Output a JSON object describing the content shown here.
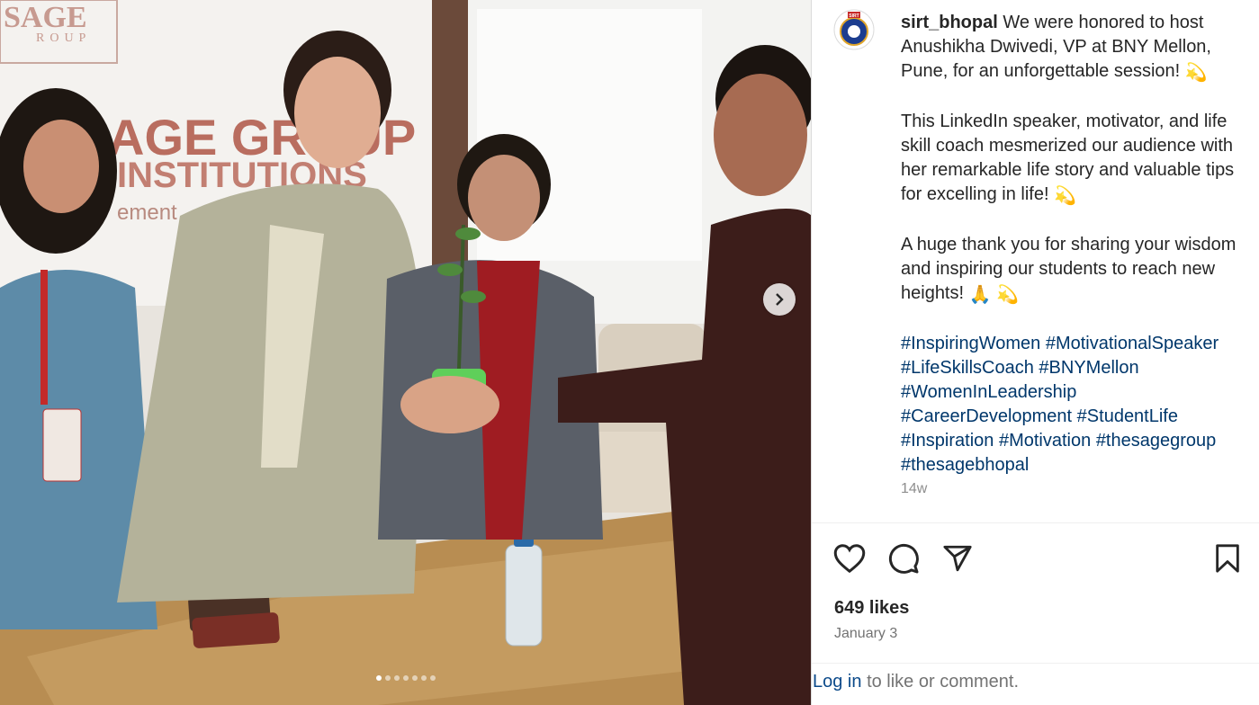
{
  "post": {
    "username": "sirt_bhopal",
    "avatar_text": "SIRT",
    "caption_paragraphs": [
      "We were honored to host Anushikha Dwivedi, VP at BNY Mellon, Pune, for an unforgettable session!",
      "This LinkedIn speaker, motivator, and life skill coach mesmerized our audience with her remarkable life story and valuable tips for excelling in life!",
      "A huge thank you for sharing your wisdom and inspiring our students to reach new heights!"
    ],
    "hashtags": [
      "#InspiringWomen",
      "#MotivationalSpeaker",
      "#LifeSkillsCoach",
      "#BNYMellon",
      "#WomenInLeadership",
      "#CareerDevelopment",
      "#StudentLife",
      "#Inspiration",
      "#Motivation",
      "#thesagegroup",
      "#thesagebhopal"
    ],
    "time_ago": "14w",
    "likes": "649 likes",
    "date": "January 3"
  },
  "media": {
    "banner_text_1": "SAGE",
    "banner_text_2": "ROUP",
    "banner_text_3": "AGE GROUP",
    "banner_text_4": "INSTITUTIONS",
    "banner_text_5": "ement",
    "slide_count": 7,
    "active_slide": 0
  },
  "actions": {
    "like_icon": "heart-icon",
    "comment_icon": "comment-icon",
    "share_icon": "paper-plane-icon",
    "save_icon": "bookmark-icon"
  },
  "login": {
    "link": "Log in",
    "rest": "to like or comment."
  },
  "colors": {
    "hashtag": "#00376b",
    "muted": "#8e8e8e",
    "text": "#262626"
  }
}
